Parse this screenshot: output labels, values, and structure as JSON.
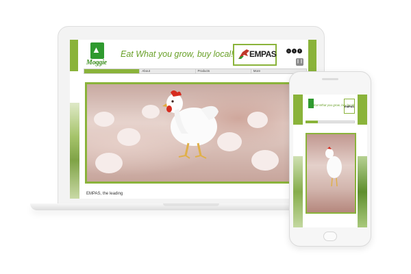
{
  "laptop": {
    "logo_text": "Moggie",
    "tagline": "Eat What you grow, buy local!",
    "partner_logo": "EMPAS",
    "social_icons": [
      "instagram-icon",
      "twitter-icon",
      "facebook-icon"
    ],
    "nav": {
      "items": [
        "",
        "About",
        "Products",
        "More"
      ]
    },
    "caption": "EMPAS, the leading"
  },
  "phone": {
    "tagline": "Eat What you grow, buy local!",
    "partner_logo": "EMPAS"
  },
  "colors": {
    "brand_green": "#8ab33a",
    "logo_green": "#2f9a2f",
    "tagline_green": "#6aa12a"
  }
}
